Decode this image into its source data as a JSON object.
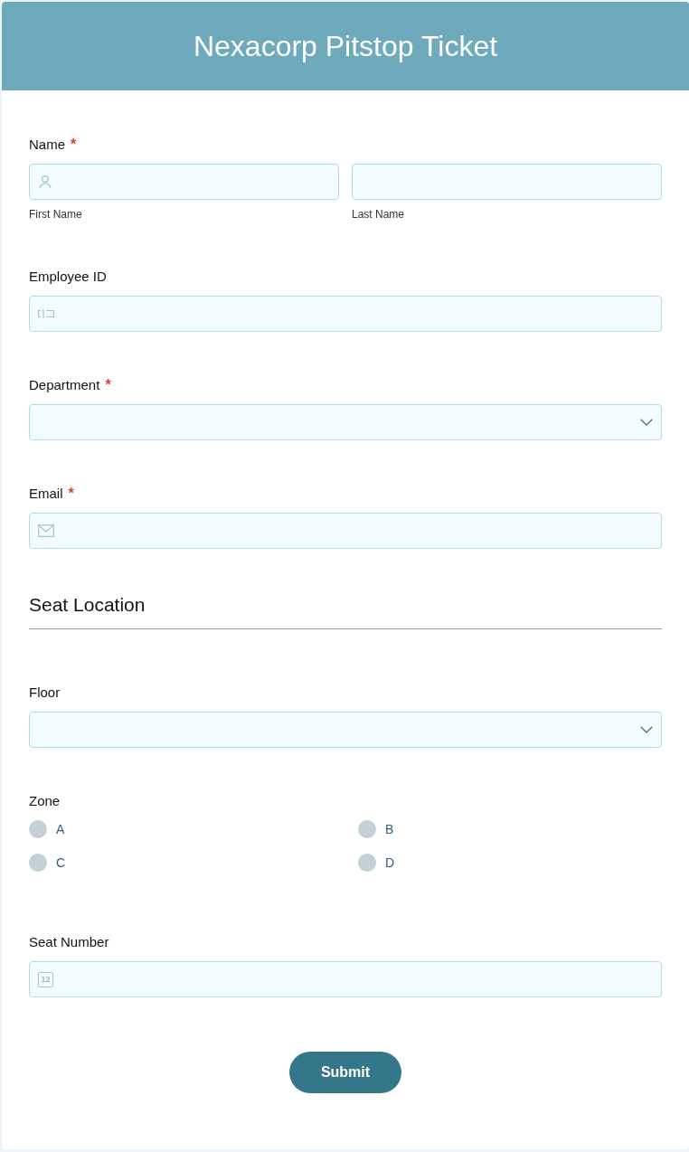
{
  "header": {
    "title": "Nexacorp Pitstop Ticket"
  },
  "fields": [
    {
      "kind": "name",
      "label": "Name",
      "required_mark": "*",
      "parts": [
        {
          "sublabel": "First Name"
        },
        {
          "sublabel": "Last Name"
        }
      ]
    },
    {
      "kind": "id",
      "label": "Employee ID"
    },
    {
      "kind": "select",
      "label": "Department",
      "required_mark": "*"
    },
    {
      "kind": "email",
      "label": "Email",
      "required_mark": "*"
    },
    {
      "kind": "section",
      "title": "Seat Location"
    },
    {
      "kind": "select",
      "label": "Floor"
    },
    {
      "kind": "radio",
      "label": "Zone",
      "options": [
        {
          "label": "A",
          "selected": false
        },
        {
          "label": "B",
          "selected": false
        },
        {
          "label": "C",
          "selected": false
        },
        {
          "label": "D",
          "selected": false
        }
      ]
    },
    {
      "kind": "number",
      "label": "Seat Number",
      "icon_text": "12"
    }
  ],
  "submit": {
    "label": "Submit"
  }
}
